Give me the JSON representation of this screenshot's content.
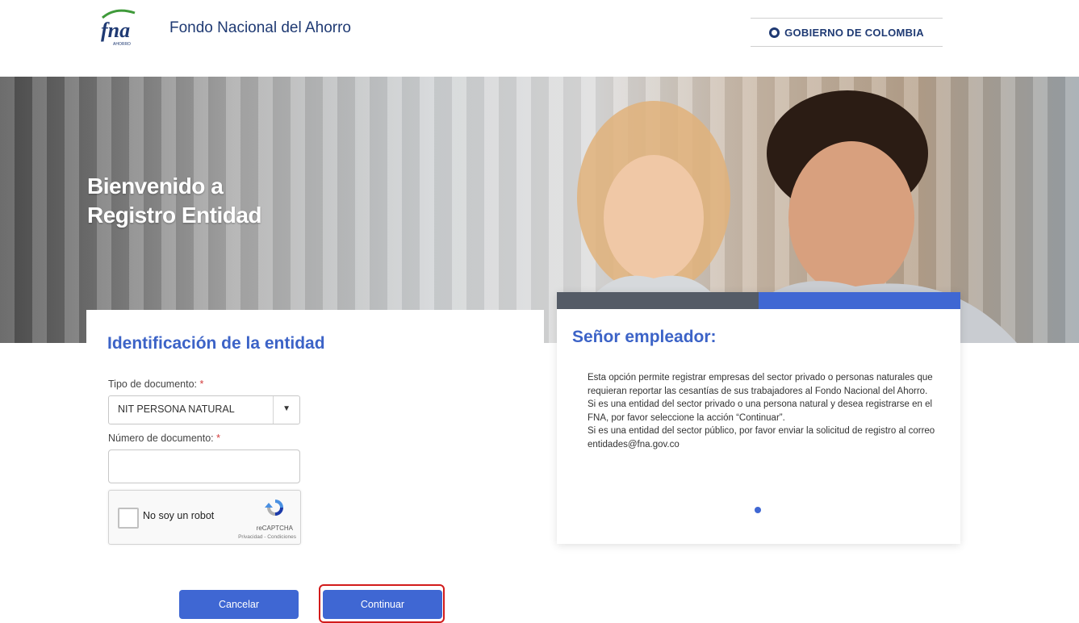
{
  "header": {
    "brand_name": "Fondo Nacional del Ahorro",
    "logo_text": "fna",
    "logo_subtext": "AHORRO",
    "gov_label": "GOBIERNO DE COLOMBIA"
  },
  "hero": {
    "title_line1": "Bienvenido a",
    "title_line2": "Registro Entidad"
  },
  "form": {
    "title": "Identificación de la entidad",
    "doc_type_label": "Tipo de documento:",
    "doc_type_value": "NIT PERSONA NATURAL",
    "doc_number_label": "Número de documento:",
    "doc_number_value": "",
    "required_mark": "*",
    "recaptcha_label": "No soy un robot",
    "recaptcha_brand": "reCAPTCHA",
    "recaptcha_links": "Privacidad - Condiciones"
  },
  "actions": {
    "cancel_label": "Cancelar",
    "continue_label": "Continuar"
  },
  "info": {
    "title": "Señor empleador:",
    "paragraphs": [
      "Esta opción permite registrar empresas del sector privado o personas naturales que requieran reportar las cesantías de sus trabajadores al Fondo Nacional del Ahorro.",
      "Si es una entidad del sector privado o una persona natural y desea registrarse en el FNA, por favor seleccione la acción “Continuar”.",
      "Si es una entidad del sector público, por favor enviar la solicitud de registro al correo entidades@fna.gov.co"
    ]
  },
  "colors": {
    "accent": "#3f67d3",
    "brand_dark": "#1f3a73",
    "highlight": "#d21b1b",
    "bar_dark": "#545b66"
  },
  "icons": {
    "logo": "fna-logo",
    "seal": "colombia-seal-icon",
    "dropdown": "chevron-down-icon",
    "recaptcha": "recaptcha-icon"
  }
}
